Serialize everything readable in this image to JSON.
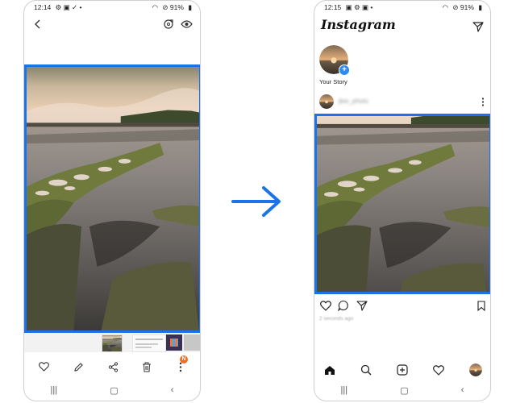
{
  "colors": {
    "highlight": "#1a73e8",
    "badge": "#f26b21",
    "arrow": "#1a73e8"
  },
  "left_phone": {
    "status_time": "12:14",
    "status_battery": "91%",
    "badge_text": "N",
    "top_icons": [
      "back-arrow-icon",
      "rotate-icon",
      "eye-icon"
    ],
    "bottom_actions": [
      "heart-icon",
      "pencil-icon",
      "share-icon",
      "trash-icon",
      "more-icon"
    ]
  },
  "right_phone": {
    "status_time": "12:15",
    "status_battery": "91%",
    "app_title": "Instagram",
    "story_label": "Your Story",
    "username": "jlee_photo",
    "post_time": "2 seconds ago",
    "post_actions": [
      "heart-icon",
      "comment-icon",
      "send-icon",
      "bookmark-icon"
    ],
    "bottom_nav": [
      "home-icon",
      "search-icon",
      "add-post-icon",
      "heart-icon",
      "profile-avatar"
    ]
  }
}
